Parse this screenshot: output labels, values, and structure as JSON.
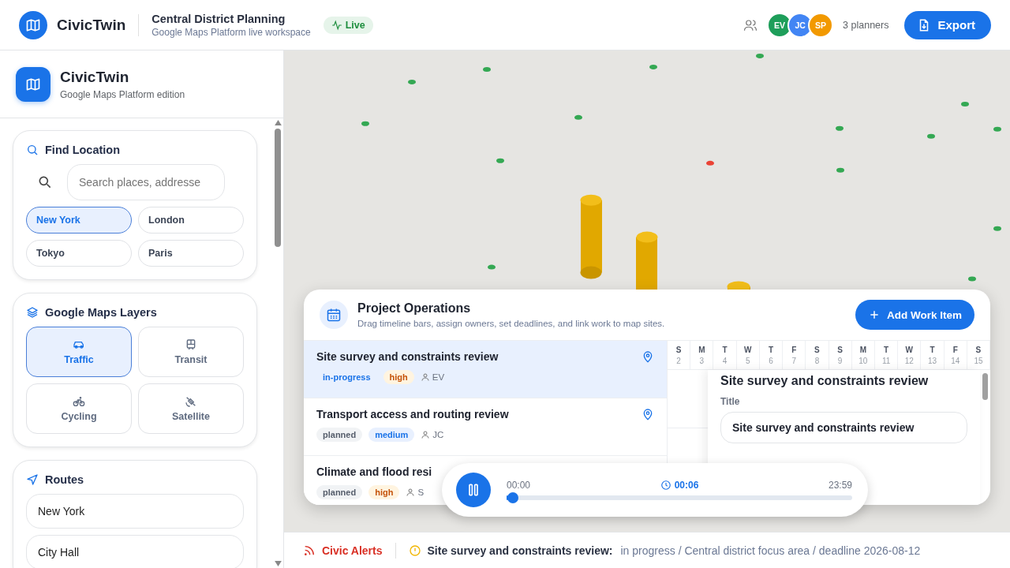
{
  "header": {
    "brand": "CivicTwin",
    "project_title": "Central District Planning",
    "project_subtitle": "Google Maps Platform live workspace",
    "status_badge": "Live",
    "planners": [
      {
        "initials": "EV",
        "color": "#1e9e5a"
      },
      {
        "initials": "JC",
        "color": "#4285f4"
      },
      {
        "initials": "SP",
        "color": "#f29900"
      }
    ],
    "planners_count": "3 planners",
    "export_button": "Export"
  },
  "sidebar": {
    "brand": {
      "name": "CivicTwin",
      "subtitle": "Google Maps Platform edition"
    },
    "find_location": {
      "title": "Find Location",
      "search_placeholder": "Search places, addresse",
      "cities": [
        {
          "label": "New York",
          "selected": true
        },
        {
          "label": "London",
          "selected": false
        },
        {
          "label": "Tokyo",
          "selected": false
        },
        {
          "label": "Paris",
          "selected": false
        }
      ]
    },
    "layers": {
      "title": "Google Maps Layers",
      "items": [
        {
          "label": "Traffic",
          "kind": "traffic",
          "selected": true
        },
        {
          "label": "Transit",
          "kind": "transit",
          "selected": false
        },
        {
          "label": "Cycling",
          "kind": "cycling",
          "selected": false
        },
        {
          "label": "Satellite",
          "kind": "satellite",
          "selected": false
        }
      ]
    },
    "routes": {
      "title": "Routes",
      "stops": [
        "New York",
        "City Hall"
      ]
    }
  },
  "operations": {
    "title": "Project Operations",
    "subtitle": "Drag timeline bars, assign owners, set deadlines, and link work to map sites.",
    "add_button": "Add Work Item",
    "tasks": [
      {
        "title": "Site survey and constraints review",
        "status": "in-progress",
        "priority": "high",
        "owner": "EV",
        "selected": true,
        "linked": true
      },
      {
        "title": "Transport access and routing review",
        "status": "planned",
        "priority": "medium",
        "owner": "JC",
        "selected": false,
        "linked": true
      },
      {
        "title": "Climate and flood resi",
        "status": "planned",
        "priority": "high",
        "owner": "S",
        "selected": false
      }
    ],
    "days": [
      {
        "weekday": "S",
        "day": "2"
      },
      {
        "weekday": "M",
        "day": "3"
      },
      {
        "weekday": "T",
        "day": "4"
      },
      {
        "weekday": "W",
        "day": "5"
      },
      {
        "weekday": "T",
        "day": "6"
      },
      {
        "weekday": "F",
        "day": "7"
      },
      {
        "weekday": "S",
        "day": "8"
      },
      {
        "weekday": "S",
        "day": "9"
      },
      {
        "weekday": "M",
        "day": "10"
      },
      {
        "weekday": "T",
        "day": "11"
      },
      {
        "weekday": "W",
        "day": "12"
      },
      {
        "weekday": "T",
        "day": "13"
      },
      {
        "weekday": "F",
        "day": "14"
      },
      {
        "weekday": "S",
        "day": "15"
      }
    ],
    "detail": {
      "heading": "Site survey and constraints review",
      "title_label": "Title",
      "title_value": "Site survey and constraints review"
    }
  },
  "playback": {
    "playing": true,
    "start": "00:00",
    "current": "00:06",
    "end": "23:59",
    "level": 0.004
  },
  "alerts": {
    "title": "Civic Alerts",
    "item_title": "Site survey and constraints review:",
    "item_text": "in progress / Central district focus area / deadline 2026-08-12"
  }
}
